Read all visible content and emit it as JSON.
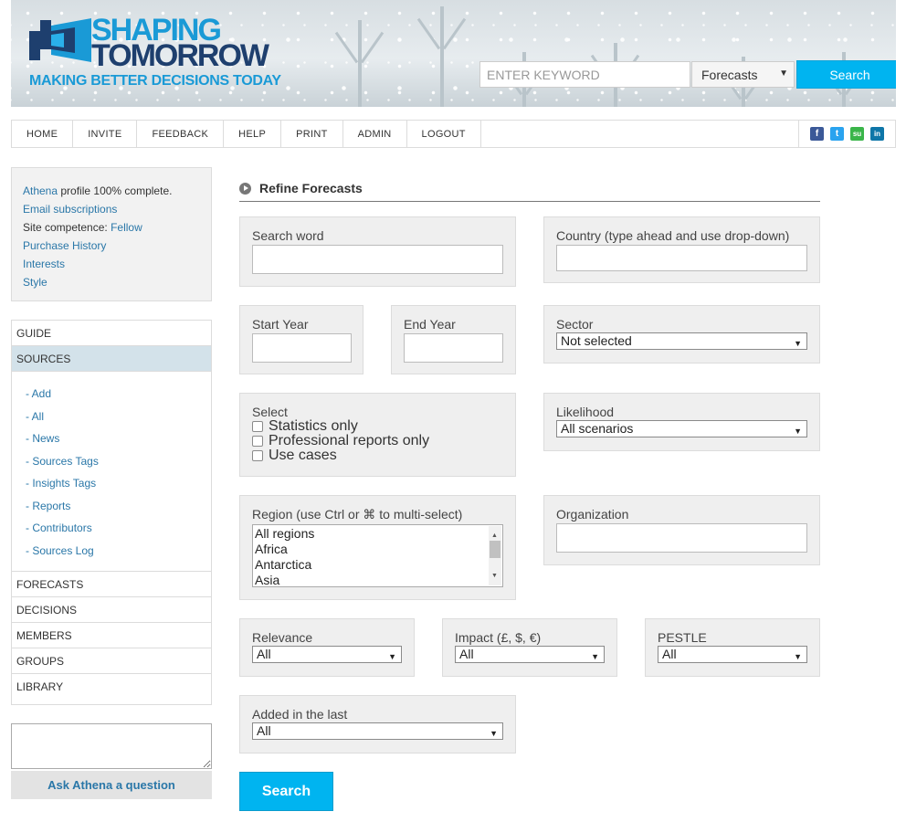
{
  "header": {
    "logo": {
      "line1": "SHAPING",
      "line2": "TOMORROW",
      "tagline": "MAKING BETTER DECISIONS TODAY"
    },
    "search": {
      "placeholder": "ENTER KEYWORD",
      "type_selected": "Forecasts",
      "button_label": "Search"
    }
  },
  "nav": {
    "items": [
      "HOME",
      "INVITE",
      "FEEDBACK",
      "HELP",
      "PRINT",
      "ADMIN",
      "LOGOUT"
    ],
    "social": [
      {
        "name": "facebook-icon",
        "glyph": "f",
        "color": "#3b5998"
      },
      {
        "name": "twitter-icon",
        "glyph": "t",
        "color": "#2aa3ef"
      },
      {
        "name": "stumbleupon-icon",
        "glyph": "su",
        "color": "#3ab54a"
      },
      {
        "name": "linkedin-icon",
        "glyph": "in",
        "color": "#0e76a8"
      }
    ]
  },
  "sidebar": {
    "profile": {
      "athena": "Athena",
      "complete_text": " profile 100% complete.",
      "email": "Email subscriptions",
      "competence_label": "Site competence: ",
      "competence_value": "Fellow",
      "purchase": "Purchase History",
      "interests": "Interests",
      "style": "Style"
    },
    "menu_top": [
      "GUIDE",
      "SOURCES"
    ],
    "submenu": [
      "- Add",
      "- All",
      "- News",
      "- Sources Tags",
      "- Insights Tags",
      "- Reports",
      "- Contributors",
      "- Sources Log"
    ],
    "menu_bottom": [
      "FORECASTS",
      "DECISIONS",
      "MEMBERS",
      "GROUPS",
      "LIBRARY"
    ],
    "ask_button": "Ask Athena a question"
  },
  "main": {
    "title": "Refine Forecasts",
    "search_word": "Search word",
    "country": "Country (type ahead and use drop-down)",
    "start_year": "Start Year",
    "end_year": "End Year",
    "sector_label": "Sector",
    "sector_value": "Not selected",
    "select_label": "Select",
    "checkboxes": [
      "Statistics only",
      "Professional reports only",
      "Use cases"
    ],
    "likelihood_label": "Likelihood",
    "likelihood_value": "All scenarios",
    "region_label": "Region (use Ctrl or ⌘ to multi-select)",
    "regions": [
      "All regions",
      "Africa",
      "Antarctica",
      "Asia"
    ],
    "organization": "Organization",
    "relevance_label": "Relevance",
    "relevance_value": "All",
    "impact_label": "Impact (£, $, €)",
    "impact_value": "All",
    "pestle_label": "PESTLE",
    "pestle_value": "All",
    "added_label": "Added in the last",
    "added_value": "All",
    "search_button": "Search"
  }
}
